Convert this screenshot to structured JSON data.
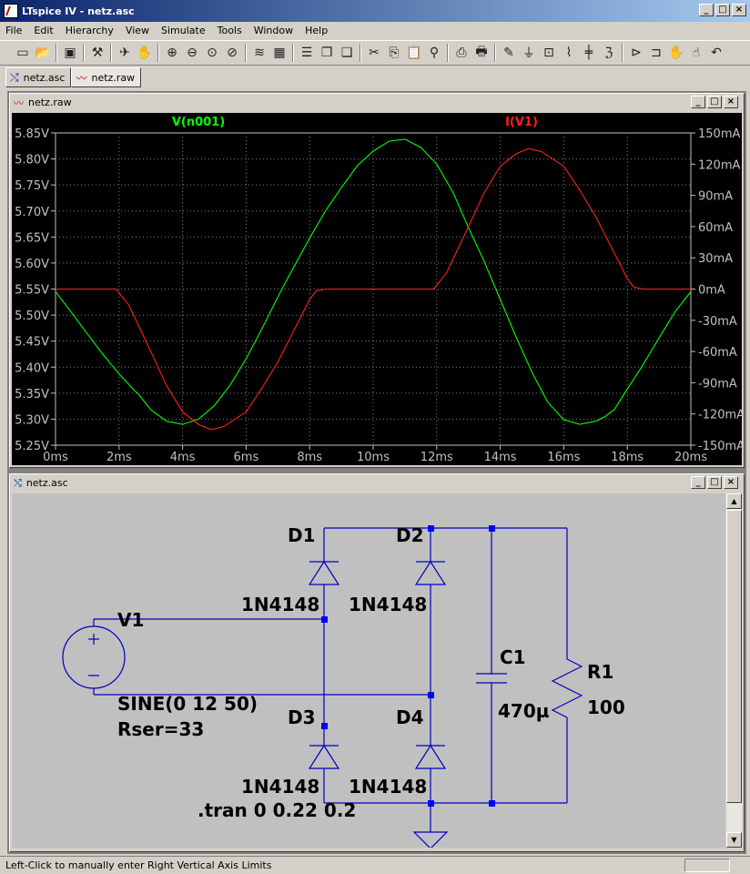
{
  "app": {
    "title": "LTspice IV - netz.asc"
  },
  "menu": [
    "File",
    "Edit",
    "Hierarchy",
    "View",
    "Simulate",
    "Tools",
    "Window",
    "Help"
  ],
  "toolbar_icons": [
    "new-schematic-icon",
    "open-icon",
    "save-icon",
    "control-panel-icon",
    "run-icon",
    "halt-icon",
    "zoom-in-icon",
    "zoom-out-icon",
    "zoom-full-icon",
    "cancel-zoom-icon",
    "plot-settings-icon",
    "autorange-icon",
    "tile-horizontal-icon",
    "cascade-icon",
    "close-all-icon",
    "cut-icon",
    "copy-icon",
    "paste-icon",
    "find-icon",
    "print-setup-icon",
    "print-icon",
    "wire-icon",
    "ground-icon",
    "label-icon",
    "resistor-icon",
    "capacitor-icon",
    "inductor-icon",
    "diode-icon",
    "component-icon",
    "move-icon",
    "drag-icon",
    "undo-icon"
  ],
  "tabs": [
    {
      "label": "netz.asc"
    },
    {
      "label": "netz.raw"
    }
  ],
  "waveform_window": {
    "title": "netz.raw"
  },
  "schematic_window": {
    "title": "netz.asc"
  },
  "chart_data": {
    "type": "line",
    "xlabel": "",
    "xlim": [
      0,
      20
    ],
    "x_unit": "ms",
    "x_ticks": [
      "0ms",
      "2ms",
      "4ms",
      "6ms",
      "8ms",
      "10ms",
      "12ms",
      "14ms",
      "16ms",
      "18ms",
      "20ms"
    ],
    "left_axis": {
      "ylim": [
        5.25,
        5.85
      ],
      "ticks": [
        "5.85V",
        "5.80V",
        "5.75V",
        "5.70V",
        "5.65V",
        "5.60V",
        "5.55V",
        "5.50V",
        "5.45V",
        "5.40V",
        "5.35V",
        "5.30V",
        "5.25V"
      ]
    },
    "right_axis": {
      "ylim": [
        -150,
        150
      ],
      "unit": "mA",
      "ticks": [
        "150mA",
        "120mA",
        "90mA",
        "60mA",
        "30mA",
        "0mA",
        "-30mA",
        "-60mA",
        "-90mA",
        "-120mA",
        "-150mA"
      ]
    },
    "grid": true,
    "series": [
      {
        "name": "V(n001)",
        "color": "#00ff00",
        "axis": "left",
        "x": [
          0,
          0.5,
          1,
          1.5,
          2,
          2.5,
          2.6,
          3,
          3.5,
          4,
          4.5,
          5,
          5.5,
          6,
          6.5,
          7,
          7.3,
          7.6,
          8,
          8.5,
          9,
          9.5,
          10,
          10.5,
          11,
          11.5,
          12,
          12.5,
          12.6,
          13,
          13.5,
          14,
          14.5,
          15,
          15.5,
          16,
          16.5,
          17,
          17.3,
          17.6,
          18,
          18.5,
          19,
          19.5,
          20
        ],
        "y": [
          5.545,
          5.505,
          5.464,
          5.424,
          5.387,
          5.354,
          5.349,
          5.318,
          5.296,
          5.29,
          5.3,
          5.326,
          5.366,
          5.416,
          5.474,
          5.535,
          5.57,
          5.603,
          5.648,
          5.7,
          5.745,
          5.787,
          5.815,
          5.834,
          5.838,
          5.822,
          5.79,
          5.737,
          5.724,
          5.668,
          5.602,
          5.53,
          5.458,
          5.39,
          5.332,
          5.299,
          5.29,
          5.296,
          5.305,
          5.319,
          5.358,
          5.405,
          5.456,
          5.506,
          5.545
        ]
      },
      {
        "name": "I(V1)",
        "color": "#ff2020",
        "axis": "right",
        "x": [
          0,
          1,
          1.9,
          2.3,
          3,
          3.5,
          4,
          4.5,
          4.9,
          5.3,
          6,
          6.5,
          7,
          7.5,
          8,
          8.2,
          8.5,
          10,
          11.9,
          12.3,
          13,
          13.5,
          14,
          14.5,
          14.9,
          15.3,
          16,
          16.5,
          17,
          17.5,
          18,
          18.2,
          18.5,
          20
        ],
        "y": [
          0,
          0,
          0,
          -15,
          -60,
          -93,
          -118,
          -130,
          -135,
          -132,
          -118,
          -95,
          -70,
          -40,
          -10,
          -2,
          0,
          0,
          0,
          15,
          60,
          93,
          118,
          130,
          135,
          132,
          118,
          95,
          70,
          40,
          10,
          2,
          0,
          0
        ]
      }
    ]
  },
  "schematic": {
    "components": {
      "V1": {
        "ref": "V1",
        "value": "SINE(0 12 50)",
        "param": "Rser=33"
      },
      "D1": {
        "ref": "D1",
        "model": "1N4148"
      },
      "D2": {
        "ref": "D2",
        "model": "1N4148"
      },
      "D3": {
        "ref": "D3",
        "model": "1N4148"
      },
      "D4": {
        "ref": "D4",
        "model": "1N4148"
      },
      "C1": {
        "ref": "C1",
        "value": "470µ"
      },
      "R1": {
        "ref": "R1",
        "value": "100"
      }
    },
    "directive": ".tran 0 0.22 0.2",
    "wire_color": "#0000c0",
    "node_color": "#0000ff"
  },
  "status": {
    "text": "Left-Click to manually enter Right Vertical Axis Limits"
  }
}
